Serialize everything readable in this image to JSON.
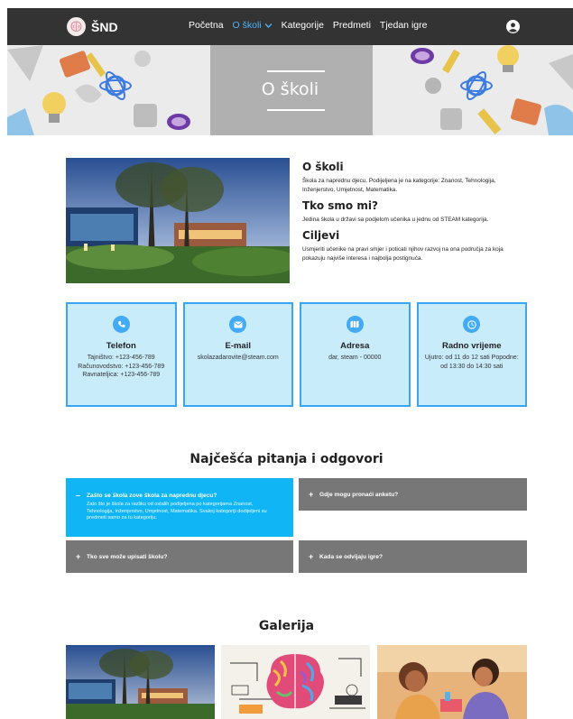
{
  "brand": {
    "name": "ŠND",
    "logo_icon": "brain-icon"
  },
  "nav": {
    "links": [
      {
        "label": "Početna"
      },
      {
        "label": "O školi",
        "active": true
      },
      {
        "label": "Kategorije"
      },
      {
        "label": "Predmeti"
      },
      {
        "label": "Tjedan igre"
      }
    ],
    "user_icon": "user-circle-icon"
  },
  "hero": {
    "title": "O školi"
  },
  "about": {
    "sections": [
      {
        "heading": "O školi",
        "text": "Škola za naprednu djecu. Podijeljena je na kategorije: Znanost, Tehnologija, Inženjerstvo, Umjetnost, Matematika."
      },
      {
        "heading": "Tko smo mi?",
        "text": "Jedina škola u državi sa podjelom učenika u jednu od STEAM kategorija."
      },
      {
        "heading": "Ciljevi",
        "text": "Usmjeriti učenike na pravi smjer i poticati njihov razvoj na ona područja za koja pokazuju najviše interesa i najbolja postignuća."
      }
    ]
  },
  "cards": [
    {
      "icon": "phone-icon",
      "title": "Telefon",
      "text": "Tajništvo: +123-456-789 Računovodstvo: +123-456-789 Ravnateljica: +123-456-789"
    },
    {
      "icon": "envelope-icon",
      "title": "E-mail",
      "text": "skolazadarovite@steam.com"
    },
    {
      "icon": "map-icon",
      "title": "Adresa",
      "text": "dar, steam - 00000"
    },
    {
      "icon": "clock-icon",
      "title": "Radno vrijeme",
      "text": "Ujutro: od 11 do 12 sati Popodne: od 13:30 do 14:30 sati"
    }
  ],
  "faq": {
    "title": "Najčešća pitanja i odgovori",
    "items": [
      {
        "symbol": "–",
        "question": "Zašto se škola zove škola za naprednu djecu?",
        "answer": "Zato što je škola za razliku od ostalih podijeljena po kategorijama Znanost, Tehnologija, Inženjerstvo, Umjetnost, Matematika. Svakoj kategoriji dodijeljeni su predmeti samo za tu kategoriju.",
        "open": true
      },
      {
        "symbol": "+",
        "question": "Gdje mogu pronaći anketu?"
      },
      {
        "symbol": "+",
        "question": "Tko sve može upisati školu?"
      },
      {
        "symbol": "+",
        "question": "Kada se odvijaju igre?"
      }
    ],
    "colors": {
      "open": "#0fb5f5",
      "closed": "#777777"
    }
  },
  "gallery": {
    "title": "Galerija",
    "images": [
      "school-building-photo",
      "brain-illustration",
      "kids-science-photo"
    ]
  },
  "colors": {
    "accent": "#3aa5f3",
    "card_bg": "#c9ecfb",
    "navbar": "#333333"
  }
}
